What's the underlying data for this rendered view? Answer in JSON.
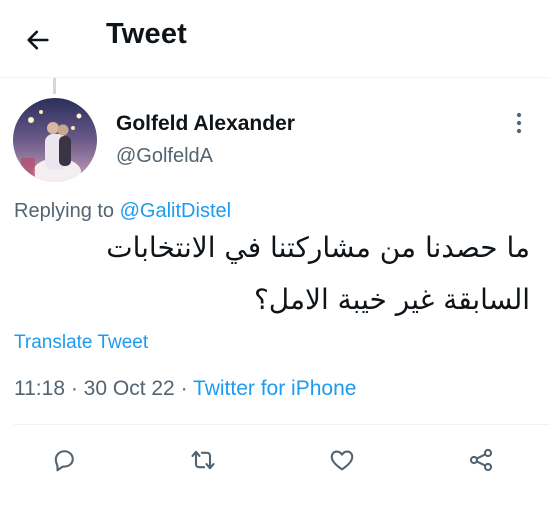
{
  "header": {
    "title": "Tweet",
    "back_icon": "arrow-left-icon"
  },
  "tweet": {
    "author": {
      "display_name": "Golfeld Alexander",
      "handle": "@GolfeldA"
    },
    "replying_to_prefix": "Replying to ",
    "replying_to_handle": "@GalitDistel",
    "text_line1": "ما حصدنا من مشاركتنا في الانتخابات",
    "text_line2": "السابقة غير خيبة الامل؟",
    "translate_label": "Translate Tweet",
    "time": "11:18",
    "separator": " · ",
    "date": "30 Oct 22",
    "source": "Twitter for iPhone"
  },
  "actions": {
    "icons": [
      "reply-icon",
      "retweet-icon",
      "like-icon",
      "share-icon"
    ]
  },
  "colors": {
    "accent": "#1d9bf0",
    "text_primary": "#0f1419",
    "text_secondary": "#536471",
    "divider": "#eff3f4"
  }
}
